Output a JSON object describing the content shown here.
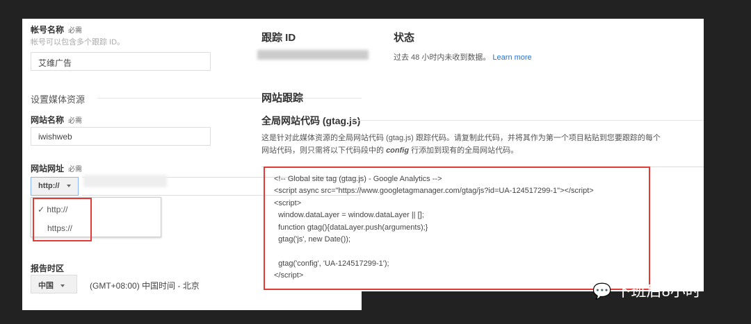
{
  "account": {
    "label": "帐号名称",
    "required": "必需",
    "hint": "帐号可以包含多个跟踪 ID。",
    "value": "艾维广告"
  },
  "property_section": "设置媒体资源",
  "site_name": {
    "label": "网站名称",
    "required": "必需",
    "value": "iwishweb"
  },
  "site_url": {
    "label": "网站网址",
    "required": "必需",
    "protocol": "http://",
    "options": [
      {
        "label": "http://",
        "checked": true
      },
      {
        "label": "https://",
        "checked": false
      }
    ]
  },
  "timezone": {
    "label": "报告时区",
    "country": "中国",
    "zone": "(GMT+08:00) 中国时间 - 北京"
  },
  "tracking": {
    "label": "跟踪 ID"
  },
  "status": {
    "label": "状态",
    "text": "过去 48 小时内未收到数据。",
    "link": "Learn more"
  },
  "website_tracking": "网站跟踪",
  "gtag": {
    "title": "全局网站代码 (gtag.js)",
    "desc1": "这是针对此媒体资源的全局网站代码 (gtag.js) 跟踪代码。请复制此代码，并将其作为第一个项目粘贴到您要跟踪的每个",
    "desc2_a": "网站代码，则只需将以下代码段中的 ",
    "desc2_b": "config",
    "desc2_c": " 行添加到现有的全局网站代码。",
    "code": "<!-- Global site tag (gtag.js) - Google Analytics -->\n<script async src=\"https://www.googletagmanager.com/gtag/js?id=UA-124517299-1\"></script>\n<script>\n  window.dataLayer = window.dataLayer || [];\n  function gtag(){dataLayer.push(arguments);}\n  gtag('js', new Date());\n\n  gtag('config', 'UA-124517299-1');\n</script>"
  },
  "watermark": "下班后8小时",
  "colors": {
    "accent": "#1a73e8",
    "highlight": "#e53935"
  }
}
